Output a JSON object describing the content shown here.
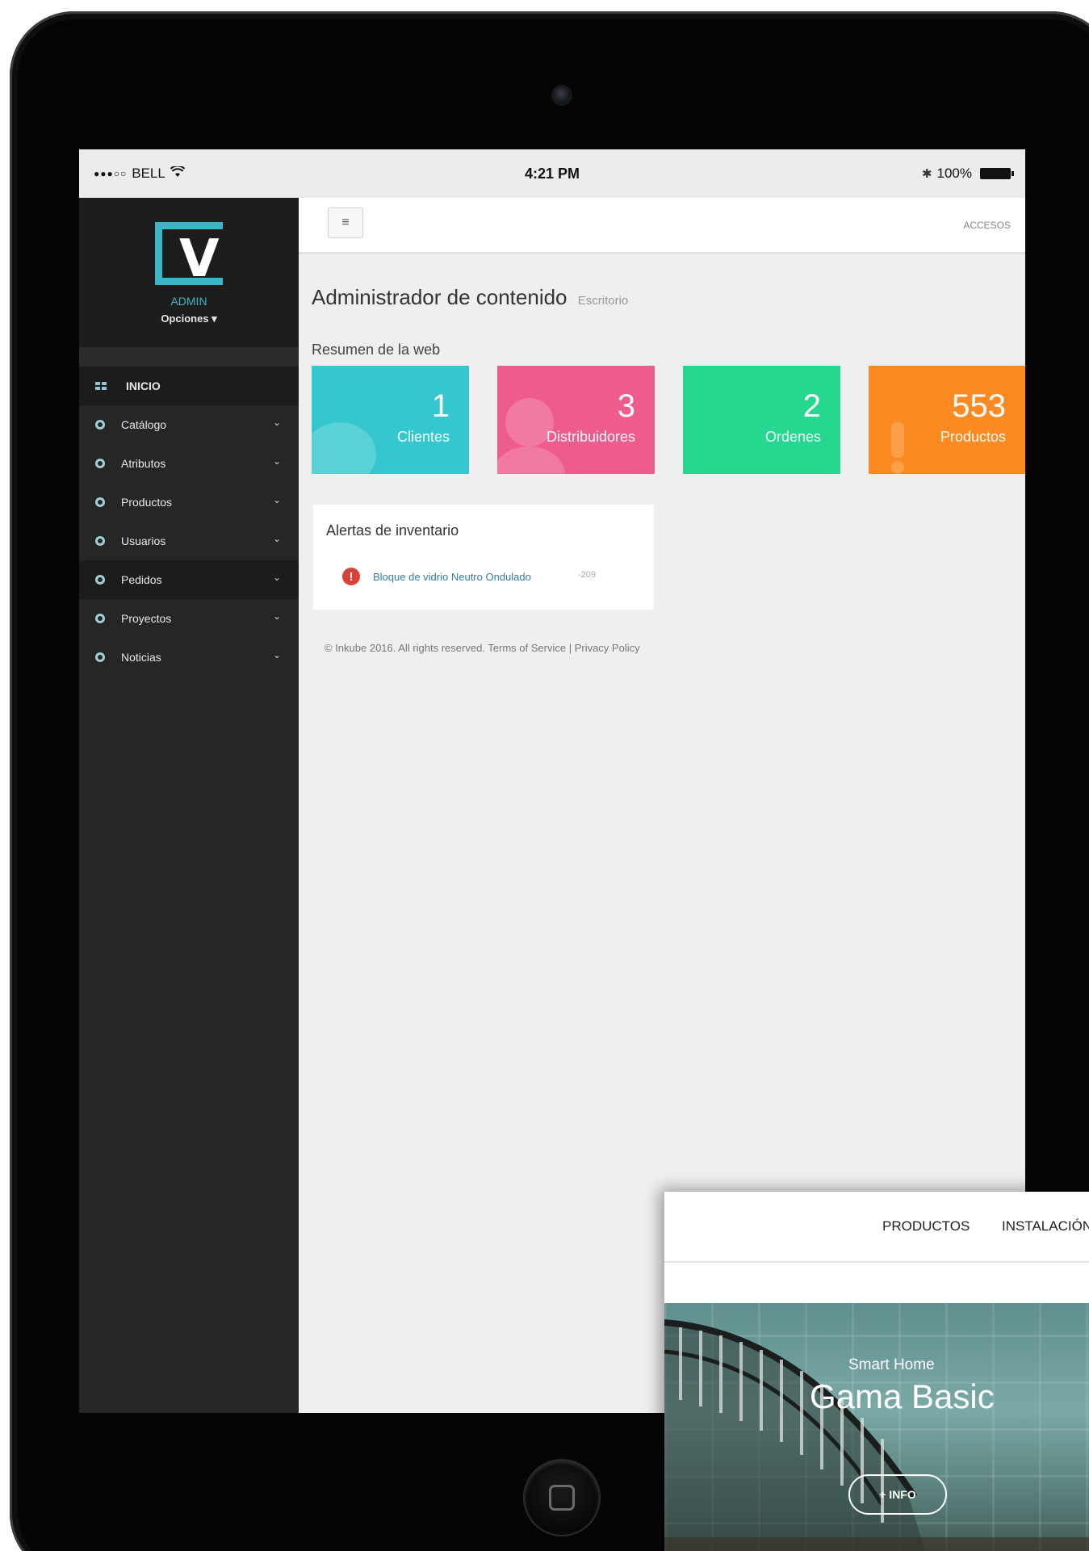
{
  "statusbar": {
    "carrier": "BELL",
    "signal_dots": "●●●○○",
    "wifi_icon": "wifi-icon",
    "time": "4:21 PM",
    "bluetooth_icon": "bluetooth-icon",
    "battery_percent": "100%"
  },
  "sidebar": {
    "brand_letter": "V",
    "role": "ADMIN",
    "options": "Opciones ▾",
    "items": [
      {
        "label": "INICIO",
        "icon": "grid-icon"
      },
      {
        "label": "Catálogo",
        "icon": "circle-icon"
      },
      {
        "label": "Atributos",
        "icon": "circle-icon"
      },
      {
        "label": "Productos",
        "icon": "circle-icon"
      },
      {
        "label": "Usuarios",
        "icon": "circle-icon"
      },
      {
        "label": "Pedidos",
        "icon": "circle-icon"
      },
      {
        "label": "Proyectos",
        "icon": "circle-icon"
      },
      {
        "label": "Noticias",
        "icon": "circle-icon"
      }
    ],
    "active_item": "Pedidos"
  },
  "topbar": {
    "menu_icon": "≡",
    "accesos": "ACCESOS"
  },
  "main": {
    "title": "Administrador de contenido",
    "subtitle": "Escritorio",
    "summary_label": "Resumen de la web",
    "cards": [
      {
        "value": "1",
        "label": "Clientes",
        "color": "#35c7cf"
      },
      {
        "value": "3",
        "label": "Distribuidores",
        "color": "#ee5c8e"
      },
      {
        "value": "2",
        "label": "Ordenes",
        "color": "#26d88f"
      },
      {
        "value": "553",
        "label": "Productos",
        "color": "#fb8a22"
      }
    ],
    "alerts": {
      "title": "Alertas de inventario",
      "icon": "!",
      "item": "Bloque de vidrio Neutro Ondulado",
      "qty": "-209"
    },
    "footer": "© Inkube 2016. All rights reserved. Terms of Service | Privacy Policy"
  },
  "website": {
    "nav": [
      "PRODUCTOS",
      "INSTALACIÓN"
    ],
    "hero_kicker": "Smart Home",
    "hero_title": "Gama Basic",
    "hero_button": "+ INFO"
  }
}
